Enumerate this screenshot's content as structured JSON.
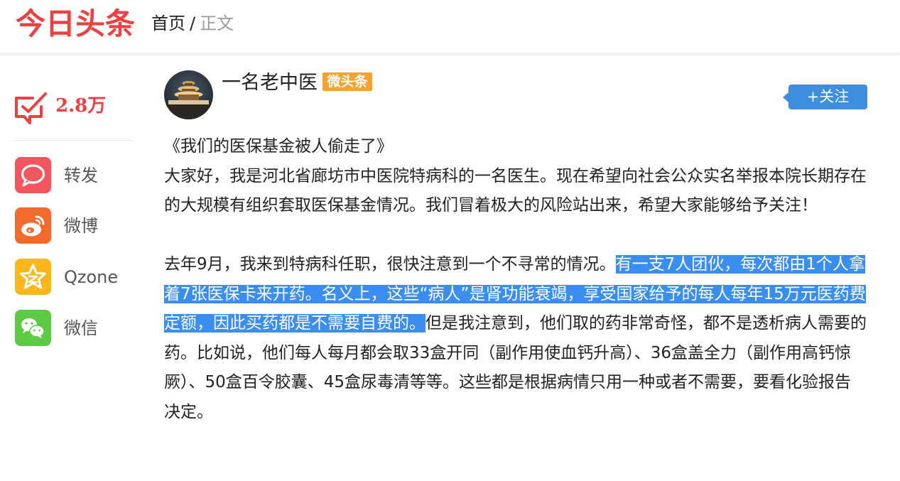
{
  "header": {
    "logo_text": "今日头条",
    "breadcrumb": {
      "home": "首页",
      "separator": "/",
      "current": "正文"
    }
  },
  "sidebar": {
    "like_count": "2.8万",
    "share_items": [
      {
        "label": "转发",
        "icon": "repost-icon",
        "color": "#f2565f"
      },
      {
        "label": "微博",
        "icon": "weibo-icon",
        "color": "#f26b2d"
      },
      {
        "label": "Qzone",
        "icon": "qzone-icon",
        "color": "#fbb71b"
      },
      {
        "label": "微信",
        "icon": "wechat-icon",
        "color": "#5ccb43"
      }
    ]
  },
  "author": {
    "name": "一名老中医",
    "badge": "微头条",
    "follow_label": "+关注"
  },
  "article": {
    "title": "《我们的医保基金被人偷走了》",
    "para1": "大家好，我是河北省廊坊市中医院特病科的一名医生。现在希望向社会公众实名举报本院长期存在的大规模有组织套取医保基金情况。我们冒着极大的风险站出来，希望大家能够给予关注！",
    "para2_before": "去年9月，我来到特病科任职，很快注意到一个不寻常的情况。",
    "para2_highlight": "有一支7人团伙，每次都由1个人拿着7张医保卡来开药。名义上，这些“病人”是肾功能衰竭，享受国家给予的每人每年15万元医药费定额，因此买药都是不需要自费的。",
    "para2_after": "但是我注意到，他们取的药非常奇怪，都不是透析病人需要的药。比如说，他们每人每月都会取33盒开同（副作用使血钙升高）、36盒盖全力（副作用高钙惊厥）、50盒百令胶囊、45盒尿毒清等等。这些都是根据病情只用一种或者不需要，要看化验报告决定。"
  },
  "colors": {
    "brand_red": "#ed4040",
    "follow_blue": "#3d8fde",
    "badge_orange": "#f7a22c",
    "selection_blue": "#3a8eef"
  }
}
